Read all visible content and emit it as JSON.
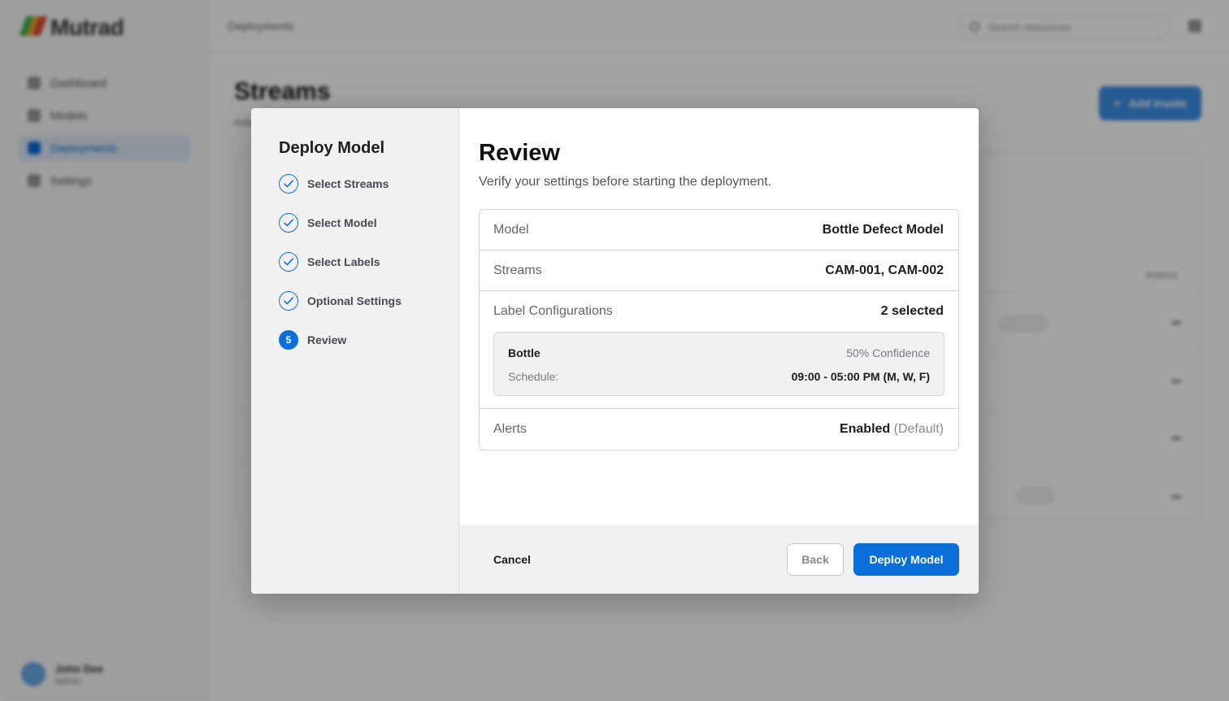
{
  "background": {
    "brand": "Mutrad",
    "nav_items": [
      "Dashboard",
      "Models",
      "Deployments",
      "Settings"
    ],
    "breadcrumb": "Deployments",
    "search_placeholder": "Search resources",
    "page_title": "Streams",
    "page_subtitle": "Add",
    "add_button_label": "Add Inside",
    "table_header_actions": "Actions",
    "user_name": "John Doe",
    "user_role": "Admin"
  },
  "modal": {
    "steps_title": "Deploy Model",
    "steps": [
      {
        "label": "Select Streams",
        "state": "done"
      },
      {
        "label": "Select Model",
        "state": "done"
      },
      {
        "label": "Select Labels",
        "state": "done"
      },
      {
        "label": "Optional Settings",
        "state": "done"
      },
      {
        "label": "Review",
        "state": "current",
        "number": "5"
      }
    ],
    "title": "Review",
    "subtitle": "Verify your settings before starting the deployment.",
    "summary": {
      "model_key": "Model",
      "model_value": "Bottle Defect Model",
      "streams_key": "Streams",
      "streams_value": "CAM-001, CAM-002",
      "labels_key": "Label Configurations",
      "labels_value": "2 selected",
      "label_card": {
        "name": "Bottle",
        "confidence": "50% Confidence",
        "schedule_key": "Schedule:",
        "schedule_value": "09:00 - 05:00 PM (M, W, F)"
      },
      "alerts_key": "Alerts",
      "alerts_value": "Enabled",
      "alerts_note": "(Default)"
    },
    "footer": {
      "cancel_label": "Cancel",
      "back_label": "Back",
      "deploy_label": "Deploy Model"
    }
  },
  "colors": {
    "accent": "#0a6fd8",
    "overlay": "rgba(0,0,0,0.36)"
  }
}
